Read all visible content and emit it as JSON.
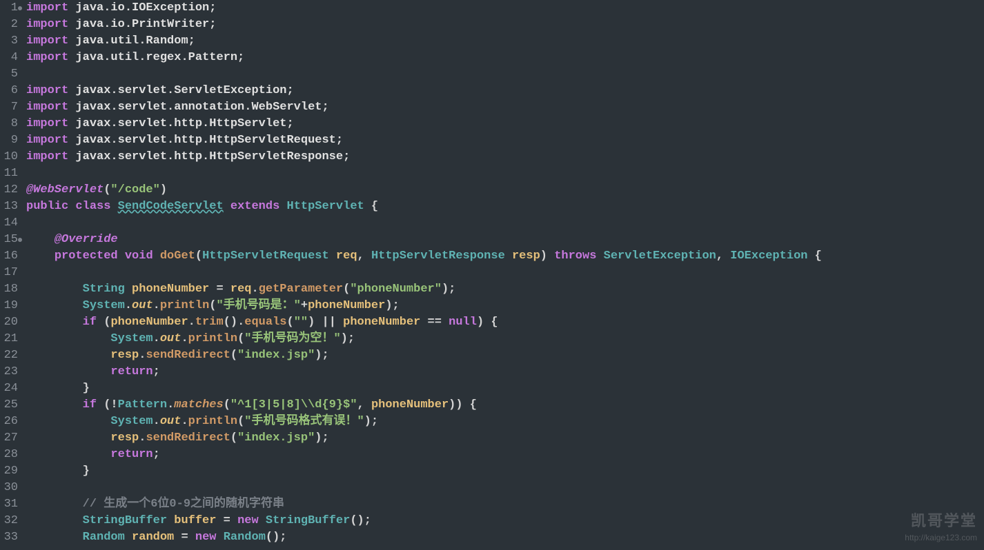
{
  "lineCount": 33,
  "dotLines": [
    1,
    15
  ],
  "watermark": {
    "title": "凯哥学堂",
    "url": "http://kaige123.com"
  },
  "code": {
    "l1": {
      "kw": "import",
      "pkg": " java.io.IOException;"
    },
    "l2": {
      "kw": "import",
      "pkg": " java.io.PrintWriter;"
    },
    "l3": {
      "kw": "import",
      "pkg": " java.util.Random;"
    },
    "l4": {
      "kw": "import",
      "pkg": " java.util.regex.Pattern;"
    },
    "l5": "",
    "l6": {
      "kw": "import",
      "pkg": " javax.servlet.ServletException;"
    },
    "l7": {
      "kw": "import",
      "pkg": " javax.servlet.annotation.WebServlet;"
    },
    "l8": {
      "kw": "import",
      "pkg": " javax.servlet.http.HttpServlet;"
    },
    "l9": {
      "kw": "import",
      "pkg": " javax.servlet.http.HttpServletRequest;"
    },
    "l10": {
      "kw": "import",
      "pkg": " javax.servlet.http.HttpServletResponse;"
    },
    "l11": "",
    "l12": {
      "annot": "@WebServlet",
      "paren": "(",
      "str": "\"/code\"",
      "paren2": ")"
    },
    "l13": {
      "pub": "public",
      "cls": " class ",
      "name": "SendCodeServlet",
      "ext": " extends ",
      "parent": "HttpServlet",
      "brace": " {"
    },
    "l14": "",
    "l15": {
      "indent": "    ",
      "annot": "@Override"
    },
    "l16": {
      "indent": "    ",
      "prot": "protected",
      "void": " void ",
      "fn": "doGet",
      "paren": "(",
      "t1": "HttpServletRequest",
      "p1": " req",
      "c": ", ",
      "t2": "HttpServletResponse",
      "p2": " resp",
      "paren2": ") ",
      "thr": "throws ",
      "e1": "ServletException",
      "c2": ", ",
      "e2": "IOException",
      "brace": " {"
    },
    "l17": "",
    "l18": {
      "indent": "        ",
      "type": "String",
      "var": " phoneNumber",
      "eq": " = ",
      "obj": "req",
      "dot": ".",
      "fn": "getParameter",
      "paren": "(",
      "str": "\"phoneNumber\"",
      "paren2": ");"
    },
    "l19": {
      "indent": "        ",
      "cls": "System",
      "dot": ".",
      "out": "out",
      "dot2": ".",
      "fn": "println",
      "paren": "(",
      "str": "\"手机号码是：\"",
      "plus": "+",
      "var": "phoneNumber",
      "paren2": ");"
    },
    "l20": {
      "indent": "        ",
      "if": "if",
      "paren": " (",
      "var": "phoneNumber",
      "dot": ".",
      "fn": "trim",
      "paren2": "().",
      "fn2": "equals",
      "paren3": "(",
      "str": "\"\"",
      "paren4": ") || ",
      "var2": "phoneNumber",
      "eq": " == ",
      "null": "null",
      "paren5": ") {"
    },
    "l21": {
      "indent": "            ",
      "cls": "System",
      "dot": ".",
      "out": "out",
      "dot2": ".",
      "fn": "println",
      "paren": "(",
      "str": "\"手机号码为空！\"",
      "paren2": ");"
    },
    "l22": {
      "indent": "            ",
      "var": "resp",
      "dot": ".",
      "fn": "sendRedirect",
      "paren": "(",
      "str": "\"index.jsp\"",
      "paren2": ");"
    },
    "l23": {
      "indent": "            ",
      "ret": "return",
      "semi": ";"
    },
    "l24": {
      "indent": "        ",
      "brace": "}"
    },
    "l25": {
      "indent": "        ",
      "if": "if",
      "paren": " (!",
      "cls": "Pattern",
      "dot": ".",
      "fn": "matches",
      "paren2": "(",
      "str": "\"^1[3|5|8]\\\\d{9}$\"",
      "c": ", ",
      "var": "phoneNumber",
      "paren3": ")) {"
    },
    "l26": {
      "indent": "            ",
      "cls": "System",
      "dot": ".",
      "out": "out",
      "dot2": ".",
      "fn": "println",
      "paren": "(",
      "str": "\"手机号码格式有误！\"",
      "paren2": ");"
    },
    "l27": {
      "indent": "            ",
      "var": "resp",
      "dot": ".",
      "fn": "sendRedirect",
      "paren": "(",
      "str": "\"index.jsp\"",
      "paren2": ");"
    },
    "l28": {
      "indent": "            ",
      "ret": "return",
      "semi": ";"
    },
    "l29": {
      "indent": "        ",
      "brace": "}"
    },
    "l30": "",
    "l31": {
      "indent": "        ",
      "cmt": "// 生成一个6位0-9之间的随机字符串"
    },
    "l32": {
      "indent": "        ",
      "type": "StringBuffer",
      "var": " buffer",
      "eq": " = ",
      "new": "new ",
      "ctor": "StringBuffer",
      "paren": "();"
    },
    "l33": {
      "indent": "        ",
      "type": "Random",
      "var": " random",
      "eq": " = ",
      "new": "new ",
      "ctor": "Random",
      "paren": "();"
    }
  }
}
